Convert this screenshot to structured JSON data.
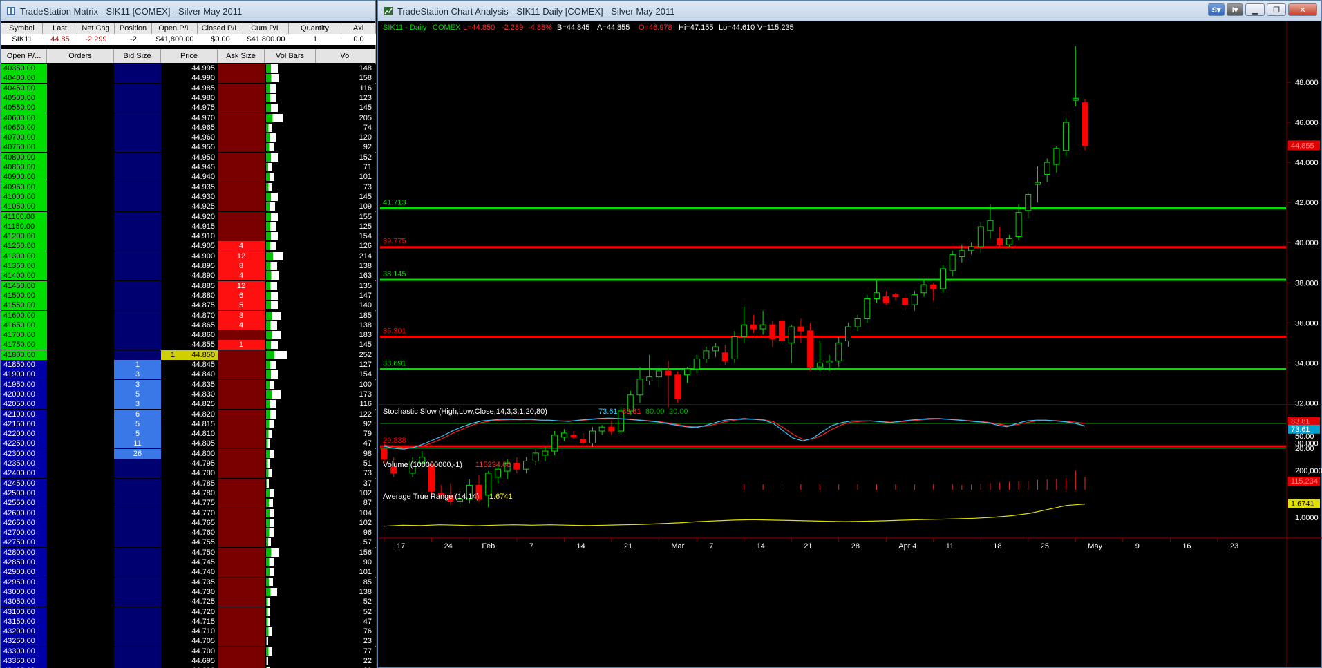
{
  "matrix": {
    "title": "TradeStation Matrix - SIK11 [COMEX] - Silver May 2011",
    "quote_headers": [
      "Symbol",
      "Last",
      "Net Chg",
      "Position",
      "Open P/L",
      "Closed P/L",
      "Cum P/L",
      "Quantity",
      "Axi"
    ],
    "quote_values": [
      "SIK11",
      "44.85",
      "-2.299",
      "-2",
      "$41,800.00",
      "$0.00",
      "$41,800.00",
      "1",
      "0.0"
    ],
    "ladder_headers": [
      "Open P/...",
      "Orders",
      "Bid Size",
      "Price",
      "Ask Size",
      "Closed P/L",
      "Vol Bars",
      "Vol"
    ],
    "rows": [
      {
        "open": "40350.00",
        "price": "44.995",
        "vol": "148",
        "bid": "",
        "ask": ""
      },
      {
        "open": "40400.00",
        "price": "44.990",
        "vol": "158",
        "bid": "",
        "ask": ""
      },
      {
        "open": "40450.00",
        "price": "44.985",
        "vol": "116",
        "bid": "",
        "ask": ""
      },
      {
        "open": "40500.00",
        "price": "44.980",
        "vol": "123",
        "bid": "",
        "ask": ""
      },
      {
        "open": "40550.00",
        "price": "44.975",
        "vol": "145",
        "bid": "",
        "ask": ""
      },
      {
        "open": "40600.00",
        "price": "44.970",
        "vol": "205",
        "bid": "",
        "ask": ""
      },
      {
        "open": "40650.00",
        "price": "44.965",
        "vol": "74",
        "bid": "",
        "ask": ""
      },
      {
        "open": "40700.00",
        "price": "44.960",
        "vol": "120",
        "bid": "",
        "ask": ""
      },
      {
        "open": "40750.00",
        "price": "44.955",
        "vol": "92",
        "bid": "",
        "ask": ""
      },
      {
        "open": "40800.00",
        "price": "44.950",
        "vol": "152",
        "bid": "",
        "ask": ""
      },
      {
        "open": "40850.00",
        "price": "44.945",
        "vol": "71",
        "bid": "",
        "ask": ""
      },
      {
        "open": "40900.00",
        "price": "44.940",
        "vol": "101",
        "bid": "",
        "ask": ""
      },
      {
        "open": "40950.00",
        "price": "44.935",
        "vol": "73",
        "bid": "",
        "ask": ""
      },
      {
        "open": "41000.00",
        "price": "44.930",
        "vol": "145",
        "bid": "",
        "ask": ""
      },
      {
        "open": "41050.00",
        "price": "44.925",
        "vol": "109",
        "bid": "",
        "ask": ""
      },
      {
        "open": "41100.00",
        "price": "44.920",
        "vol": "155",
        "bid": "",
        "ask": ""
      },
      {
        "open": "41150.00",
        "price": "44.915",
        "vol": "125",
        "bid": "",
        "ask": ""
      },
      {
        "open": "41200.00",
        "price": "44.910",
        "vol": "154",
        "bid": "",
        "ask": ""
      },
      {
        "open": "41250.00",
        "price": "44.905",
        "vol": "126",
        "bid": "",
        "ask": "4"
      },
      {
        "open": "41300.00",
        "price": "44.900",
        "vol": "214",
        "bid": "",
        "ask": "12"
      },
      {
        "open": "41350.00",
        "price": "44.895",
        "vol": "138",
        "bid": "",
        "ask": "8"
      },
      {
        "open": "41400.00",
        "price": "44.890",
        "vol": "163",
        "bid": "",
        "ask": "4"
      },
      {
        "open": "41450.00",
        "price": "44.885",
        "vol": "135",
        "bid": "",
        "ask": "12"
      },
      {
        "open": "41500.00",
        "price": "44.880",
        "vol": "147",
        "bid": "",
        "ask": "6"
      },
      {
        "open": "41550.00",
        "price": "44.875",
        "vol": "140",
        "bid": "",
        "ask": "5"
      },
      {
        "open": "41600.00",
        "price": "44.870",
        "vol": "185",
        "bid": "",
        "ask": "3"
      },
      {
        "open": "41650.00",
        "price": "44.865",
        "vol": "138",
        "bid": "",
        "ask": "4"
      },
      {
        "open": "41700.00",
        "price": "44.860",
        "vol": "183",
        "bid": "",
        "ask": ""
      },
      {
        "open": "41750.00",
        "price": "44.855",
        "vol": "145",
        "bid": "",
        "ask": "1"
      },
      {
        "open": "41800.00",
        "price": "44.850",
        "vol": "252",
        "bid": "",
        "ask": "",
        "pos": "1"
      },
      {
        "open": "41850.00",
        "price": "44.845",
        "vol": "127",
        "bid": "1",
        "ask": ""
      },
      {
        "open": "41900.00",
        "price": "44.840",
        "vol": "154",
        "bid": "3",
        "ask": ""
      },
      {
        "open": "41950.00",
        "price": "44.835",
        "vol": "100",
        "bid": "3",
        "ask": ""
      },
      {
        "open": "42000.00",
        "price": "44.830",
        "vol": "173",
        "bid": "5",
        "ask": ""
      },
      {
        "open": "42050.00",
        "price": "44.825",
        "vol": "116",
        "bid": "3",
        "ask": ""
      },
      {
        "open": "42100.00",
        "price": "44.820",
        "vol": "122",
        "bid": "6",
        "ask": ""
      },
      {
        "open": "42150.00",
        "price": "44.815",
        "vol": "92",
        "bid": "5",
        "ask": ""
      },
      {
        "open": "42200.00",
        "price": "44.810",
        "vol": "79",
        "bid": "5",
        "ask": ""
      },
      {
        "open": "42250.00",
        "price": "44.805",
        "vol": "47",
        "bid": "11",
        "ask": ""
      },
      {
        "open": "42300.00",
        "price": "44.800",
        "vol": "98",
        "bid": "26",
        "ask": ""
      },
      {
        "open": "42350.00",
        "price": "44.795",
        "vol": "51",
        "bid": "",
        "ask": ""
      },
      {
        "open": "42400.00",
        "price": "44.790",
        "vol": "73",
        "bid": "",
        "ask": ""
      },
      {
        "open": "42450.00",
        "price": "44.785",
        "vol": "37",
        "bid": "",
        "ask": ""
      },
      {
        "open": "42500.00",
        "price": "44.780",
        "vol": "102",
        "bid": "",
        "ask": ""
      },
      {
        "open": "42550.00",
        "price": "44.775",
        "vol": "87",
        "bid": "",
        "ask": ""
      },
      {
        "open": "42600.00",
        "price": "44.770",
        "vol": "104",
        "bid": "",
        "ask": ""
      },
      {
        "open": "42650.00",
        "price": "44.765",
        "vol": "102",
        "bid": "",
        "ask": ""
      },
      {
        "open": "42700.00",
        "price": "44.760",
        "vol": "96",
        "bid": "",
        "ask": ""
      },
      {
        "open": "42750.00",
        "price": "44.755",
        "vol": "57",
        "bid": "",
        "ask": ""
      },
      {
        "open": "42800.00",
        "price": "44.750",
        "vol": "156",
        "bid": "",
        "ask": ""
      },
      {
        "open": "42850.00",
        "price": "44.745",
        "vol": "90",
        "bid": "",
        "ask": ""
      },
      {
        "open": "42900.00",
        "price": "44.740",
        "vol": "101",
        "bid": "",
        "ask": ""
      },
      {
        "open": "42950.00",
        "price": "44.735",
        "vol": "85",
        "bid": "",
        "ask": ""
      },
      {
        "open": "43000.00",
        "price": "44.730",
        "vol": "138",
        "bid": "",
        "ask": ""
      },
      {
        "open": "43050.00",
        "price": "44.725",
        "vol": "52",
        "bid": "",
        "ask": ""
      },
      {
        "open": "43100.00",
        "price": "44.720",
        "vol": "52",
        "bid": "",
        "ask": ""
      },
      {
        "open": "43150.00",
        "price": "44.715",
        "vol": "47",
        "bid": "",
        "ask": ""
      },
      {
        "open": "43200.00",
        "price": "44.710",
        "vol": "76",
        "bid": "",
        "ask": ""
      },
      {
        "open": "43250.00",
        "price": "44.705",
        "vol": "23",
        "bid": "",
        "ask": ""
      },
      {
        "open": "43300.00",
        "price": "44.700",
        "vol": "77",
        "bid": "",
        "ask": ""
      },
      {
        "open": "43350.00",
        "price": "44.695",
        "vol": "22",
        "bid": "",
        "ask": ""
      },
      {
        "open": "43400.00",
        "price": "44.690",
        "vol": "38",
        "bid": "",
        "ask": ""
      }
    ]
  },
  "chart": {
    "title": "TradeStation Chart Analysis - SIK11 Daily [COMEX] - Silver May 2011",
    "header_symbol": "SIK11 - Daily",
    "header_exchange": "COMEX",
    "header_last": "L=44.850",
    "header_chg": "-2.289",
    "header_pct": "-4.88%",
    "header_bid": "B=44.845",
    "header_ask": "A=44.855",
    "header_open": "O=46.978",
    "header_hi": "Hi=47.155",
    "header_lo": "Lo=44.610",
    "header_vol": "V=115,235",
    "price_axis": [
      "48.000",
      "46.000",
      "44.000",
      "42.000",
      "40.000",
      "38.000",
      "36.000",
      "34.000",
      "32.000",
      "30.000",
      "28.000"
    ],
    "last_price_tag": "44.855",
    "levels": [
      {
        "value": 41.713,
        "label": "41.713",
        "color": "#00dd00"
      },
      {
        "value": 39.775,
        "label": "39.775",
        "color": "#ff0000"
      },
      {
        "value": 38.145,
        "label": "38.145",
        "color": "#00dd00"
      },
      {
        "value": 35.301,
        "label": "35.301",
        "color": "#ff0000"
      },
      {
        "value": 33.691,
        "label": "33.691",
        "color": "#00dd00"
      },
      {
        "value": 29.838,
        "label": "29.838",
        "color": "#ff0000"
      }
    ],
    "x_labels": [
      "17",
      "24",
      "Feb",
      "7",
      "14",
      "21",
      "Mar",
      "7",
      "14",
      "21",
      "28",
      "Apr 4",
      "11",
      "18",
      "25",
      "May",
      "9",
      "16",
      "23"
    ],
    "stoch_label": "Stochastic Slow (High,Low,Close,14,3,3,1,20,80)",
    "stoch_k": "73.61",
    "stoch_d": "83.81",
    "stoch_ob": "80.00",
    "stoch_os": "20.00",
    "stoch_axis": [
      "50.00",
      "20.00"
    ],
    "stoch_tag_k": "73.61",
    "stoch_tag_d": "83.81",
    "volume_label": "Volume (100000000,-1)",
    "volume_value": "115234.60",
    "volume_axis": "200,000",
    "volume_tag": "115,234",
    "atr_label": "Average True Range (14,14)",
    "atr_value": "1.6741",
    "atr_axis": "1.0000",
    "atr_tag": "1.6741"
  },
  "chart_data": {
    "type": "candlestick",
    "title": "SIK11 - Daily",
    "xlabel": "",
    "ylabel": "",
    "ylim": [
      26.5,
      50.0
    ],
    "candles": [
      {
        "i": 0,
        "o": 29.7,
        "h": 30.0,
        "l": 29.0,
        "c": 29.2
      },
      {
        "i": 1,
        "o": 28.8,
        "h": 29.3,
        "l": 28.3,
        "c": 28.5
      },
      {
        "i": 3,
        "o": 28.5,
        "h": 29.3,
        "l": 28.3,
        "c": 29.1
      },
      {
        "i": 4,
        "o": 29.0,
        "h": 29.6,
        "l": 28.8,
        "c": 29.3
      },
      {
        "i": 5,
        "o": 28.9,
        "h": 29.0,
        "l": 27.4,
        "c": 27.6
      },
      {
        "i": 6,
        "o": 27.5,
        "h": 27.9,
        "l": 27.2,
        "c": 27.4
      },
      {
        "i": 7,
        "o": 27.4,
        "h": 28.0,
        "l": 26.9,
        "c": 27.1
      },
      {
        "i": 8,
        "o": 27.1,
        "h": 27.6,
        "l": 26.8,
        "c": 27.2
      },
      {
        "i": 9,
        "o": 27.2,
        "h": 28.2,
        "l": 27.0,
        "c": 27.9
      },
      {
        "i": 10,
        "o": 27.9,
        "h": 28.4,
        "l": 27.1,
        "c": 27.2
      },
      {
        "i": 11,
        "o": 27.4,
        "h": 28.6,
        "l": 26.8,
        "c": 28.5
      },
      {
        "i": 12,
        "o": 28.3,
        "h": 28.9,
        "l": 28.0,
        "c": 28.7
      },
      {
        "i": 13,
        "o": 28.6,
        "h": 29.2,
        "l": 28.2,
        "c": 29.0
      },
      {
        "i": 14,
        "o": 29.0,
        "h": 29.3,
        "l": 28.5,
        "c": 28.7
      },
      {
        "i": 15,
        "o": 28.7,
        "h": 29.3,
        "l": 28.5,
        "c": 29.1
      },
      {
        "i": 16,
        "o": 29.1,
        "h": 29.7,
        "l": 28.9,
        "c": 29.5
      },
      {
        "i": 17,
        "o": 29.4,
        "h": 29.8,
        "l": 29.1,
        "c": 29.6
      },
      {
        "i": 18,
        "o": 29.6,
        "h": 30.6,
        "l": 29.4,
        "c": 30.4
      },
      {
        "i": 19,
        "o": 30.3,
        "h": 30.7,
        "l": 30.1,
        "c": 30.5
      },
      {
        "i": 20,
        "o": 30.4,
        "h": 30.6,
        "l": 30.2,
        "c": 30.3
      },
      {
        "i": 21,
        "o": 30.2,
        "h": 30.5,
        "l": 29.8,
        "c": 30.0
      },
      {
        "i": 22,
        "o": 30.0,
        "h": 30.8,
        "l": 29.8,
        "c": 30.6
      },
      {
        "i": 23,
        "o": 30.6,
        "h": 30.9,
        "l": 30.4,
        "c": 30.8
      },
      {
        "i": 24,
        "o": 30.8,
        "h": 31.1,
        "l": 30.4,
        "c": 30.6
      },
      {
        "i": 25,
        "o": 30.6,
        "h": 31.8,
        "l": 30.5,
        "c": 31.6
      },
      {
        "i": 26,
        "o": 31.6,
        "h": 32.6,
        "l": 31.4,
        "c": 32.4
      },
      {
        "i": 27,
        "o": 32.4,
        "h": 33.8,
        "l": 32.0,
        "c": 33.2
      },
      {
        "i": 28,
        "o": 33.1,
        "h": 34.4,
        "l": 32.9,
        "c": 33.3
      },
      {
        "i": 29,
        "o": 33.3,
        "h": 33.8,
        "l": 32.8,
        "c": 33.6
      },
      {
        "i": 30,
        "o": 33.6,
        "h": 34.1,
        "l": 31.8,
        "c": 33.4
      },
      {
        "i": 31,
        "o": 33.4,
        "h": 33.6,
        "l": 32.0,
        "c": 32.2
      },
      {
        "i": 32,
        "o": 33.4,
        "h": 33.8,
        "l": 33.0,
        "c": 33.7
      },
      {
        "i": 33,
        "o": 33.7,
        "h": 34.4,
        "l": 33.5,
        "c": 34.2
      },
      {
        "i": 34,
        "o": 34.2,
        "h": 34.8,
        "l": 34.0,
        "c": 34.6
      },
      {
        "i": 35,
        "o": 34.6,
        "h": 35.0,
        "l": 34.3,
        "c": 34.8
      },
      {
        "i": 36,
        "o": 34.5,
        "h": 34.9,
        "l": 33.9,
        "c": 34.1
      },
      {
        "i": 37,
        "o": 34.2,
        "h": 35.6,
        "l": 34.0,
        "c": 35.3
      },
      {
        "i": 38,
        "o": 35.3,
        "h": 36.8,
        "l": 35.0,
        "c": 35.9
      },
      {
        "i": 39,
        "o": 35.9,
        "h": 36.4,
        "l": 35.5,
        "c": 35.7
      },
      {
        "i": 40,
        "o": 35.7,
        "h": 36.6,
        "l": 35.4,
        "c": 35.9
      },
      {
        "i": 41,
        "o": 35.9,
        "h": 36.1,
        "l": 34.8,
        "c": 35.2
      },
      {
        "i": 42,
        "o": 36.1,
        "h": 36.4,
        "l": 34.9,
        "c": 35.1
      },
      {
        "i": 43,
        "o": 35.0,
        "h": 35.9,
        "l": 34.0,
        "c": 35.8
      },
      {
        "i": 44,
        "o": 35.8,
        "h": 36.2,
        "l": 35.0,
        "c": 35.6
      },
      {
        "i": 45,
        "o": 35.6,
        "h": 36.0,
        "l": 33.6,
        "c": 33.8
      },
      {
        "i": 46,
        "o": 33.8,
        "h": 35.1,
        "l": 33.6,
        "c": 34.0
      },
      {
        "i": 47,
        "o": 34.0,
        "h": 34.4,
        "l": 33.6,
        "c": 34.1
      },
      {
        "i": 48,
        "o": 34.1,
        "h": 35.3,
        "l": 33.8,
        "c": 35.0
      },
      {
        "i": 49,
        "o": 35.1,
        "h": 36.0,
        "l": 34.8,
        "c": 35.8
      },
      {
        "i": 50,
        "o": 35.8,
        "h": 36.4,
        "l": 35.6,
        "c": 36.2
      },
      {
        "i": 51,
        "o": 36.2,
        "h": 37.4,
        "l": 36.0,
        "c": 37.2
      },
      {
        "i": 52,
        "o": 37.2,
        "h": 38.1,
        "l": 37.0,
        "c": 37.5
      },
      {
        "i": 53,
        "o": 37.3,
        "h": 37.6,
        "l": 36.9,
        "c": 37.0
      },
      {
        "i": 54,
        "o": 37.4,
        "h": 37.5,
        "l": 37.1,
        "c": 37.3
      },
      {
        "i": 55,
        "o": 37.2,
        "h": 37.5,
        "l": 36.6,
        "c": 36.9
      },
      {
        "i": 56,
        "o": 36.9,
        "h": 37.6,
        "l": 36.6,
        "c": 37.4
      },
      {
        "i": 57,
        "o": 37.5,
        "h": 38.1,
        "l": 37.3,
        "c": 37.9
      },
      {
        "i": 58,
        "o": 37.9,
        "h": 38.0,
        "l": 37.1,
        "c": 37.7
      },
      {
        "i": 59,
        "o": 37.7,
        "h": 38.9,
        "l": 37.5,
        "c": 38.7
      },
      {
        "i": 60,
        "o": 38.6,
        "h": 39.6,
        "l": 38.3,
        "c": 39.4
      },
      {
        "i": 61,
        "o": 39.3,
        "h": 39.9,
        "l": 39.0,
        "c": 39.6
      },
      {
        "i": 62,
        "o": 39.6,
        "h": 40.0,
        "l": 39.4,
        "c": 39.8
      },
      {
        "i": 63,
        "o": 39.8,
        "h": 41.0,
        "l": 39.5,
        "c": 40.8
      },
      {
        "i": 64,
        "o": 40.6,
        "h": 41.9,
        "l": 40.2,
        "c": 41.1
      },
      {
        "i": 65,
        "o": 40.2,
        "h": 40.8,
        "l": 39.8,
        "c": 39.9
      },
      {
        "i": 66,
        "o": 39.9,
        "h": 40.4,
        "l": 39.8,
        "c": 40.2
      },
      {
        "i": 67,
        "o": 40.3,
        "h": 41.9,
        "l": 40.1,
        "c": 41.5
      },
      {
        "i": 68,
        "o": 41.6,
        "h": 42.5,
        "l": 41.2,
        "c": 42.4
      },
      {
        "i": 69,
        "o": 42.9,
        "h": 43.8,
        "l": 42.0,
        "c": 43.0
      },
      {
        "i": 70,
        "o": 43.4,
        "h": 44.2,
        "l": 43.0,
        "c": 44.0
      },
      {
        "i": 71,
        "o": 43.9,
        "h": 44.8,
        "l": 43.5,
        "c": 44.7
      },
      {
        "i": 72,
        "o": 44.6,
        "h": 46.2,
        "l": 44.3,
        "c": 46.0
      },
      {
        "i": 73,
        "o": 47.1,
        "h": 49.8,
        "l": 46.8,
        "c": 47.2
      },
      {
        "i": 74,
        "o": 46.978,
        "h": 47.155,
        "l": 44.61,
        "c": 44.85
      }
    ],
    "levels": [
      41.713,
      39.775,
      38.145,
      35.301,
      33.691,
      29.838
    ]
  },
  "colors": {
    "up": "#00dd00",
    "down": "#ff0000",
    "text_green": "#00dd00"
  }
}
